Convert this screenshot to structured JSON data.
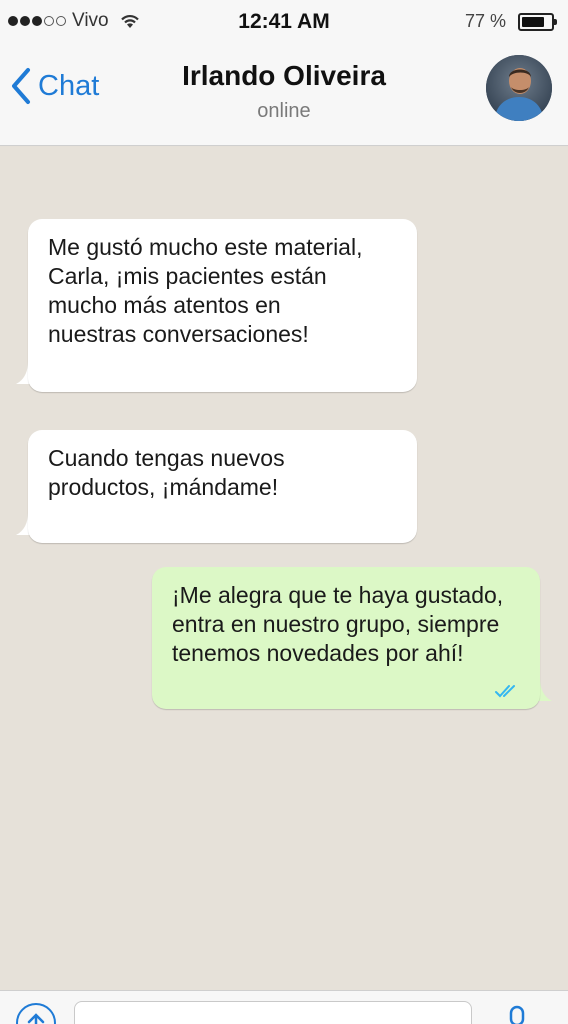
{
  "status_bar": {
    "carrier": "Vivo",
    "time": "12:41 AM",
    "battery_text": "77 %",
    "battery_level": 0.77
  },
  "nav": {
    "back_label": "Chat",
    "contact_name": "Irlando Oliveira",
    "contact_status": "online"
  },
  "messages": [
    {
      "direction": "incoming",
      "lines": [
        "Me gustó mucho este material,",
        "Carla, ¡mis pacientes están",
        "mucho más atentos en",
        "nuestras conversaciones!"
      ]
    },
    {
      "direction": "incoming",
      "lines": [
        "Cuando tengas nuevos",
        "productos, ¡mándame!"
      ]
    },
    {
      "direction": "outgoing",
      "lines": [
        "¡Me alegra que te haya gustado,",
        "entra en nuestro grupo, siempre",
        "tenemos novedades por ahí!"
      ],
      "read_status": "double-check-icon"
    }
  ],
  "composer": {
    "placeholder": ""
  },
  "colors": {
    "accent": "#1f7bd6",
    "outgoing_bubble": "#dcf8c6",
    "incoming_bubble": "#ffffff",
    "chat_background": "#e6e1d9",
    "read_ticks": "#34b7f1"
  }
}
